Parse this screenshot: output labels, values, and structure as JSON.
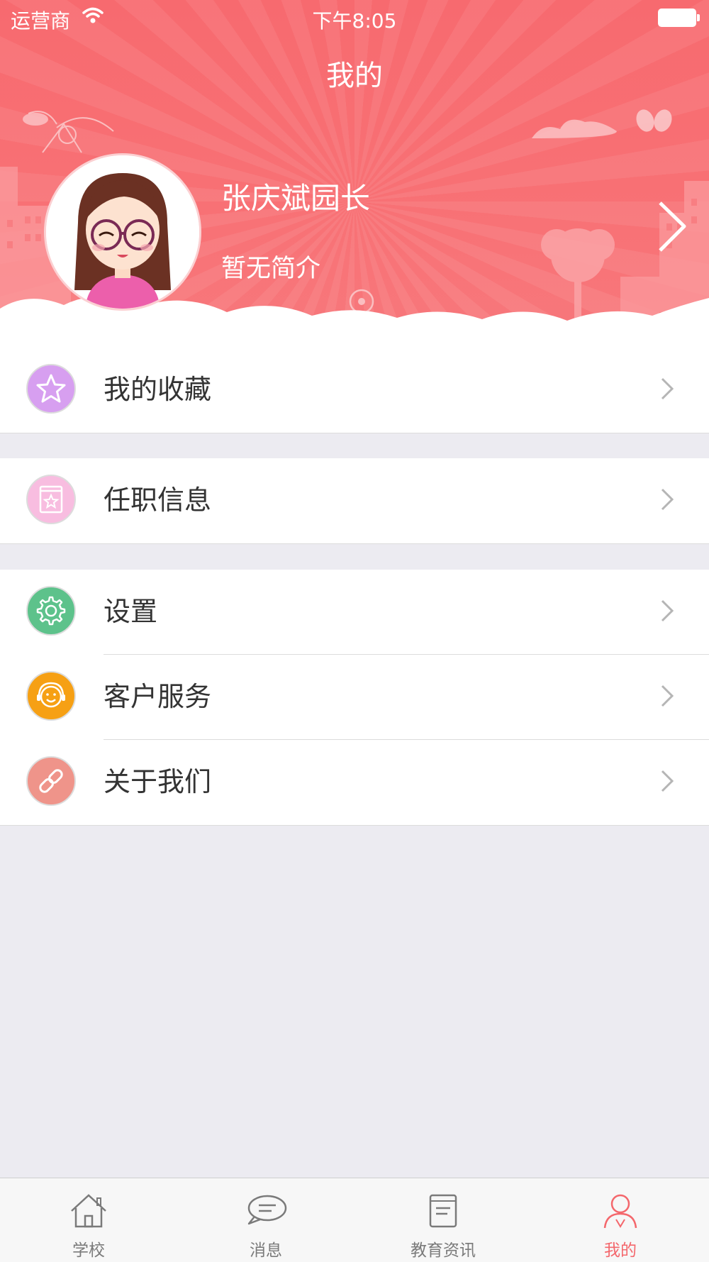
{
  "status_bar": {
    "carrier": "运营商",
    "time": "下午8:05"
  },
  "nav": {
    "title": "我的"
  },
  "profile": {
    "name": "张庆斌园长",
    "bio": "暂无简介"
  },
  "menu_groups": [
    [
      {
        "label": "我的收藏",
        "icon": "star-icon",
        "color": "#d79ff0"
      }
    ],
    [
      {
        "label": "任职信息",
        "icon": "badge-book-icon",
        "color": "#f8bde0"
      }
    ],
    [
      {
        "label": "设置",
        "icon": "gear-icon",
        "color": "#5dc28b"
      },
      {
        "label": "客户服务",
        "icon": "customer-service-icon",
        "color": "#f6a014"
      },
      {
        "label": "关于我们",
        "icon": "link-icon",
        "color": "#ef948a"
      }
    ]
  ],
  "tabbar": {
    "tabs": [
      {
        "label": "学校",
        "icon": "home-icon"
      },
      {
        "label": "消息",
        "icon": "message-icon"
      },
      {
        "label": "教育资讯",
        "icon": "news-icon"
      },
      {
        "label": "我的",
        "icon": "user-icon"
      }
    ],
    "active_index": 3,
    "active_color": "#f4676c"
  },
  "theme": {
    "header_color": "#f76a6f",
    "background": "#ecebf1"
  }
}
